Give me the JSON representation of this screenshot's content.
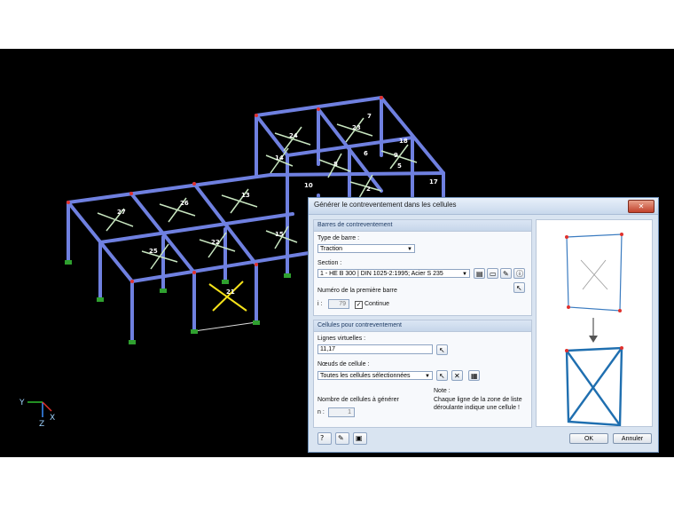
{
  "viewport": {
    "axis": {
      "y": "Y",
      "x": "X",
      "z": "Z"
    },
    "member_labels": [
      "27",
      "26",
      "25",
      "22",
      "21",
      "13",
      "14",
      "15",
      "24",
      "23",
      "7",
      "18",
      "17",
      "9",
      "10",
      "6",
      "8",
      "5",
      "2"
    ]
  },
  "dialog": {
    "title": "Générer le contreventement dans les cellules",
    "close_label": "✕",
    "bracing_section": {
      "header": "Barres de contreventement",
      "member_type_label": "Type de barre :",
      "member_type_value": "Traction",
      "section_label": "Section :",
      "section_value": "1 - HE B 300 | DIN 1025-2:1995; Acier S 235",
      "first_member_label": "Numéro de la première barre",
      "first_member_prefix": "i :",
      "first_member_value": "79",
      "continue_label": "Continue",
      "continue_checked": "✓"
    },
    "cells_section": {
      "header": "Cellules pour contreventement",
      "virtual_lines_label": "Lignes virtuelles :",
      "virtual_lines_value": "11,17",
      "cell_nodes_label": "Nœuds de cellule :",
      "cell_nodes_value": "Toutes les cellules sélectionnées",
      "count_label": "Nombre de cellules à générer",
      "count_prefix": "n :",
      "count_value": "1",
      "note_title": "Note :",
      "note_text_1": "Chaque ligne de la zone de liste",
      "note_text_2": "déroulante indique une cellule !"
    },
    "buttons": {
      "ok": "OK",
      "cancel": "Annuler"
    },
    "colors": {
      "frame": "#6b7fd9",
      "accent": "#2a6fb0",
      "node": "#e0302c"
    }
  }
}
